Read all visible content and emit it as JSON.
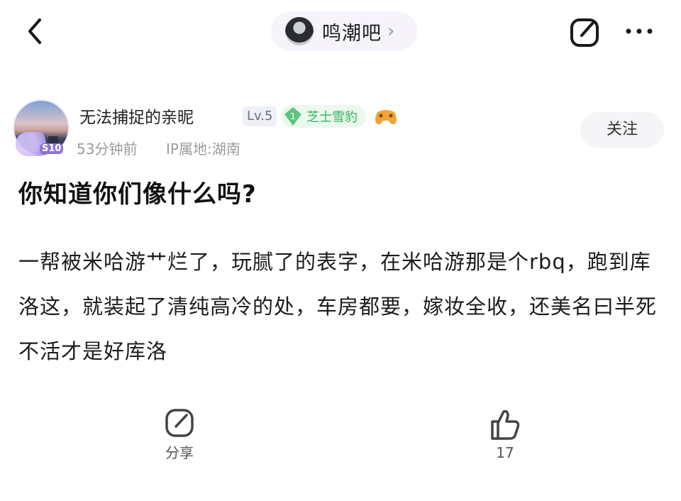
{
  "header": {
    "forum_name": "鸣潮吧",
    "back_icon": "back-arrow-icon",
    "compose_icon": "compose-icon",
    "more_icon": "more-icon"
  },
  "author": {
    "name": "无法捕捉的亲昵",
    "avatar_badge": "S10",
    "level": "Lv.5",
    "fan_level": "1",
    "fan_title": "芝士雪豹",
    "time": "53分钟前",
    "ip": "IP属地:湖南",
    "follow_label": "关注"
  },
  "post": {
    "title": "你知道你们像什么吗?",
    "body": "一帮被米哈游艹烂了，玩腻了的表字，在米哈游那是个rbq，跑到库洛这，就装起了清纯高冷的处，车房都要，嫁妆全收，还美名曰半死不活才是好库洛"
  },
  "actions": {
    "share_label": "分享",
    "like_count": "17"
  },
  "colors": {
    "fan_badge_green": "#35b55b",
    "pill_bg": "#f6f3fa",
    "muted_text": "#9a9a9f"
  }
}
